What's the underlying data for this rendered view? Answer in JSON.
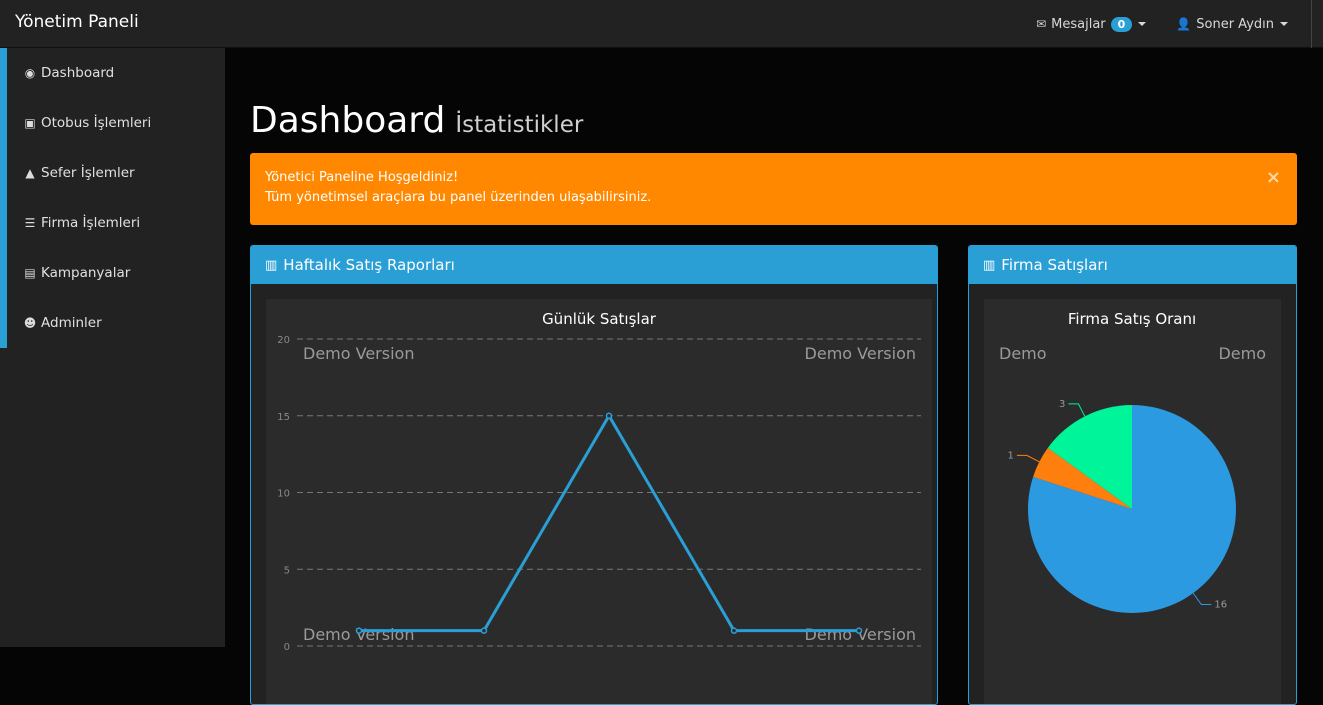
{
  "brand": "Yönetim Paneli",
  "topnav": {
    "messages_label": "Mesajlar",
    "messages_count": "0",
    "user_label": "Soner Aydın"
  },
  "sidebar": {
    "items": [
      {
        "label": "Dashboard",
        "icon": "dashboard-icon"
      },
      {
        "label": "Otobus İşlemleri",
        "icon": "bus-icon"
      },
      {
        "label": "Sefer İşlemler",
        "icon": "road-icon"
      },
      {
        "label": "Firma İşlemleri",
        "icon": "list-icon"
      },
      {
        "label": "Kampanyalar",
        "icon": "gift-icon"
      },
      {
        "label": "Adminler",
        "icon": "users-icon"
      }
    ]
  },
  "page": {
    "title": "Dashboard",
    "subtitle": "İstatistikler"
  },
  "alert": {
    "line1": "Yönetici Paneline Hoşgeldiniz!",
    "line2": "Tüm yönetimsel araçlara bu panel üzerinden ulaşabilirsiniz.",
    "close": "×"
  },
  "panels": {
    "weekly": {
      "title": "Haftalık Satış Raporları",
      "icon": "bar-chart-icon"
    },
    "firma": {
      "title": "Firma Satışları",
      "icon": "bar-chart-icon"
    }
  },
  "watermark": "Demo Version",
  "watermark_short": "Demo",
  "colors": {
    "accent": "#2a9fd6",
    "alert": "#ff8800",
    "line": "#2a9fd6",
    "pie": [
      "#2b9ae0",
      "#ff7f0e",
      "#00f59b"
    ]
  },
  "chart_data": [
    {
      "type": "line",
      "title": "Günlük Satışlar",
      "x": [
        0,
        1,
        2,
        3,
        4
      ],
      "values": [
        1,
        1,
        15,
        1,
        1
      ],
      "yticks": [
        0,
        5,
        10,
        15,
        20
      ],
      "ylim": [
        0,
        20
      ],
      "grid": true
    },
    {
      "type": "pie",
      "title": "Firma Satış Oranı",
      "values": [
        16,
        1,
        3
      ],
      "labels": [
        "16",
        "1",
        "3"
      ]
    }
  ]
}
